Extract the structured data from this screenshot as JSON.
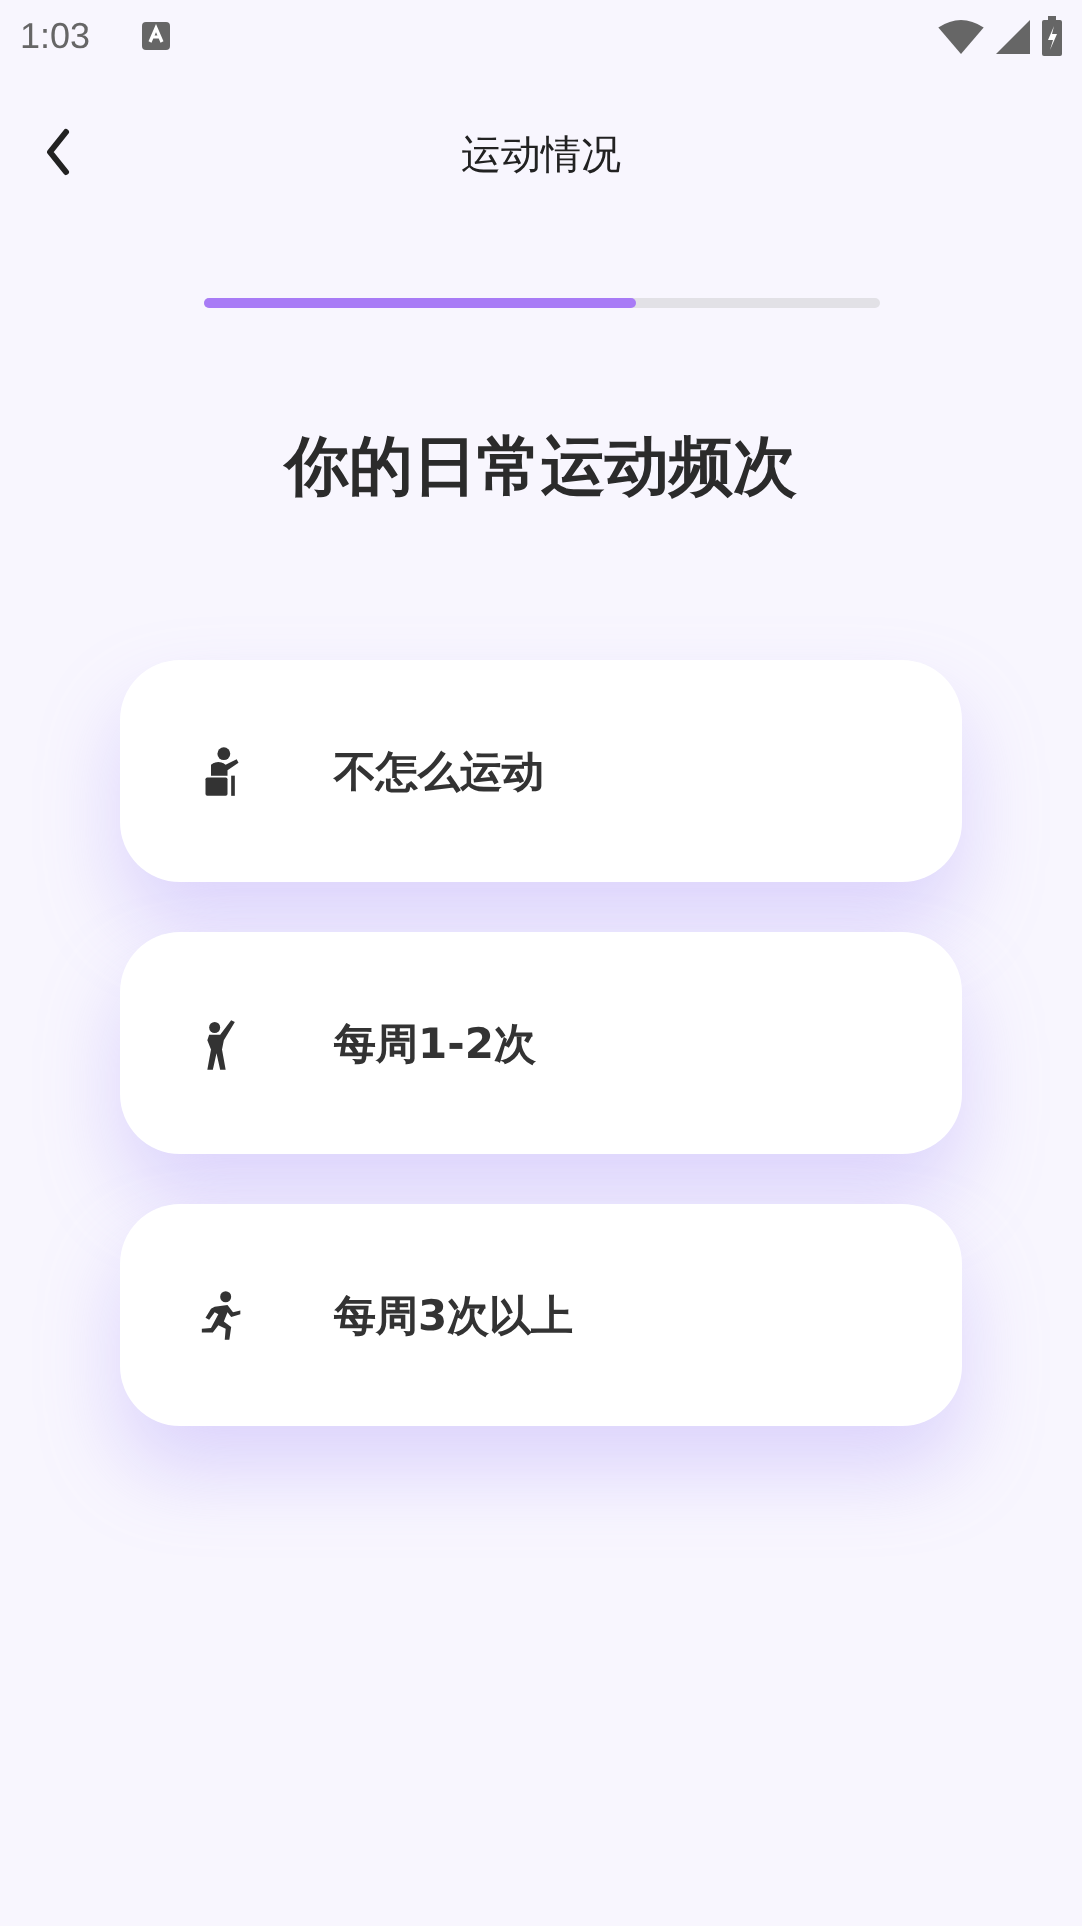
{
  "status_bar": {
    "time": "1:03"
  },
  "header": {
    "title": "运动情况"
  },
  "progress": {
    "level": 0.64
  },
  "question": "你的日常运动频次",
  "options": [
    {
      "kind": "sitting",
      "label": "不怎么运动"
    },
    {
      "kind": "standing",
      "label": "每周1-2次"
    },
    {
      "kind": "running",
      "label": "每周3次以上"
    }
  ]
}
